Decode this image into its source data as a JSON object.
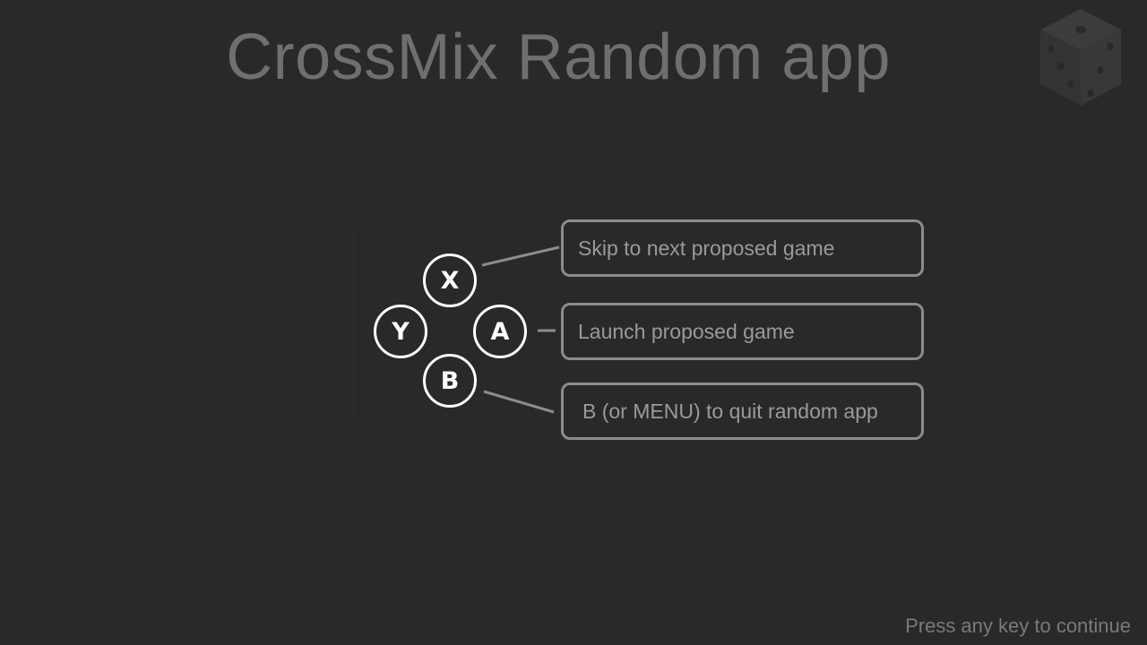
{
  "title": "CrossMix Random app",
  "icons": {
    "logo": "dice-icon"
  },
  "buttons": {
    "x": "X",
    "y": "Y",
    "a": "A",
    "b": "B"
  },
  "callouts": {
    "x_action": "Skip to next proposed game",
    "a_action": "Launch proposed game",
    "b_action": "B (or MENU) to quit random app"
  },
  "footer": "Press any key to continue",
  "colors": {
    "background": "#29292b",
    "title": "#6f6f6f",
    "button_outline": "#ffffff",
    "callout_border": "#8c8c8c",
    "callout_text": "#9a9a9a",
    "connector": "#8c8c8c"
  }
}
